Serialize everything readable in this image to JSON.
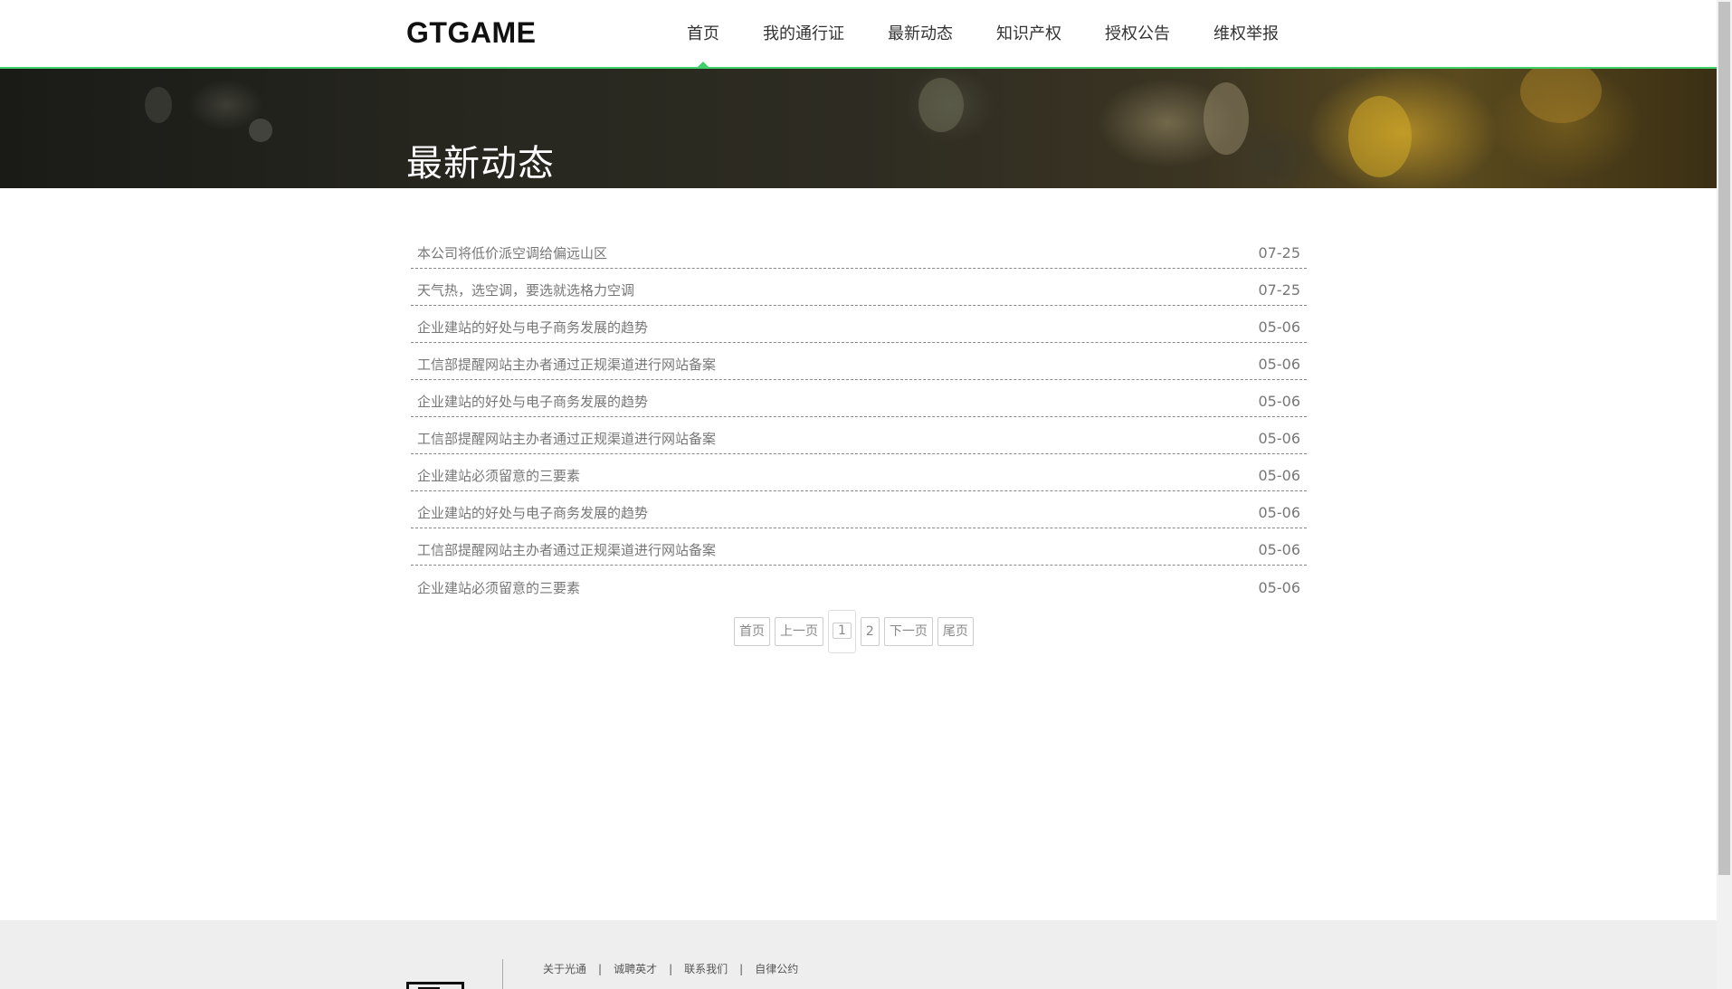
{
  "header": {
    "logo": "GTGAME",
    "nav": [
      {
        "label": "首页",
        "active": true
      },
      {
        "label": "我的通行证",
        "active": false
      },
      {
        "label": "最新动态",
        "active": false
      },
      {
        "label": "知识产权",
        "active": false
      },
      {
        "label": "授权公告",
        "active": false
      },
      {
        "label": "维权举报",
        "active": false
      }
    ]
  },
  "banner": {
    "title": "最新动态"
  },
  "news": [
    {
      "title": "本公司将低价派空调给偏远山区",
      "date": "07-25"
    },
    {
      "title": "天气热，选空调，要选就选格力空调",
      "date": "07-25"
    },
    {
      "title": "企业建站的好处与电子商务发展的趋势",
      "date": "05-06"
    },
    {
      "title": "工信部提醒网站主办者通过正规渠道进行网站备案",
      "date": "05-06"
    },
    {
      "title": "企业建站的好处与电子商务发展的趋势",
      "date": "05-06"
    },
    {
      "title": "工信部提醒网站主办者通过正规渠道进行网站备案",
      "date": "05-06"
    },
    {
      "title": "企业建站必须留意的三要素",
      "date": "05-06"
    },
    {
      "title": "企业建站的好处与电子商务发展的趋势",
      "date": "05-06"
    },
    {
      "title": "工信部提醒网站主办者通过正规渠道进行网站备案",
      "date": "05-06"
    },
    {
      "title": "企业建站必须留意的三要素",
      "date": "05-06"
    }
  ],
  "pagination": {
    "first": "首页",
    "prev": "上一页",
    "pages": [
      "1",
      "2"
    ],
    "current": "1",
    "next": "下一页",
    "last": "尾页"
  },
  "footer": {
    "links": [
      "关于光通",
      "诚聘英才",
      "联系我们",
      "自律公约"
    ],
    "separator": "|"
  }
}
